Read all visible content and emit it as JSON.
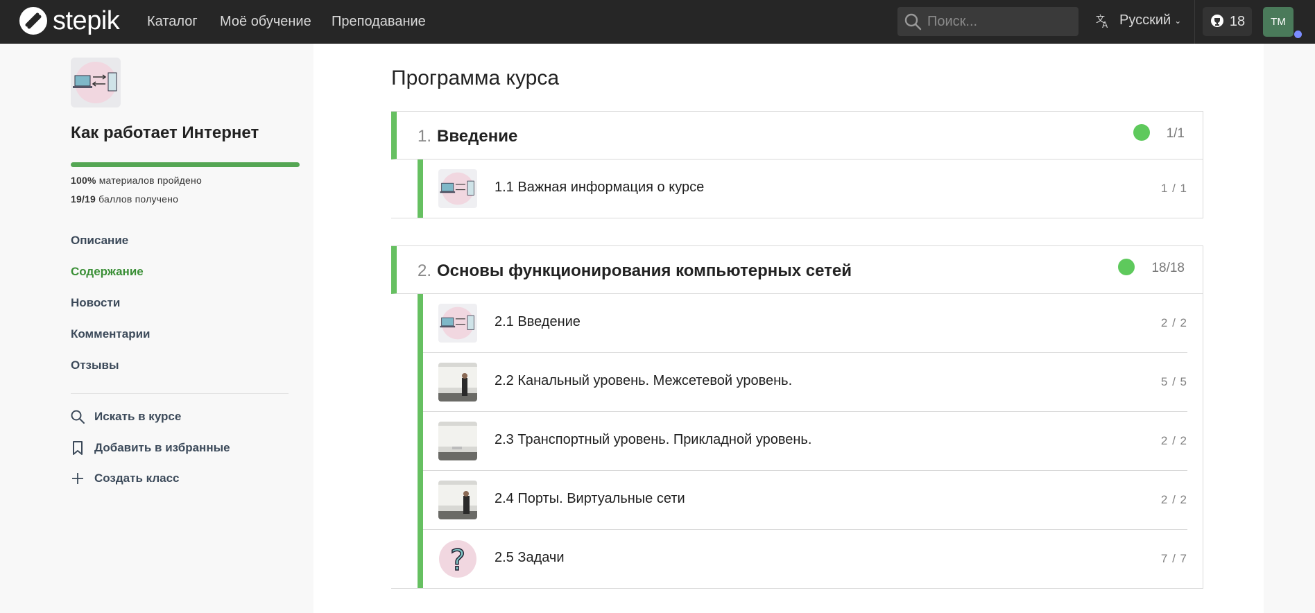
{
  "nav": {
    "logo_text": "stepik",
    "links": [
      "Каталог",
      "Моё обучение",
      "Преподавание"
    ],
    "search_placeholder": "Поиск...",
    "language": "Русский",
    "cups_count": "18",
    "avatar_initials": "TM"
  },
  "sidebar": {
    "course_title": "Как работает Интернет",
    "progress_percent": 100,
    "stat_materials_value": "100%",
    "stat_materials_label": "материалов пройдено",
    "stat_points_value": "19/19",
    "stat_points_label": "баллов получено",
    "menu": [
      "Описание",
      "Содержание",
      "Новости",
      "Комментарии",
      "Отзывы"
    ],
    "active_menu": "Содержание",
    "actions": [
      "Искать в курсе",
      "Добавить в избранные",
      "Создать класс"
    ]
  },
  "main": {
    "page_title": "Программа курса",
    "sections": [
      {
        "number": "1.",
        "title": "Введение",
        "score": "1/1",
        "lessons": [
          {
            "title": "1.1 Важная информация о курсе",
            "score": "1 / 1",
            "thumb": "network-icon"
          }
        ]
      },
      {
        "number": "2.",
        "title": "Основы функционирования компьютерных сетей",
        "score": "18/18",
        "lessons": [
          {
            "title": "2.1 Введение",
            "score": "2 / 2",
            "thumb": "network-icon"
          },
          {
            "title": "2.2 Канальный уровень. Межсетевой уровень.",
            "score": "5 / 5",
            "thumb": "lecture-photo"
          },
          {
            "title": "2.3 Транспортный уровень. Прикладной уровень.",
            "score": "2 / 2",
            "thumb": "lecture-photo"
          },
          {
            "title": "2.4 Порты. Виртуальные сети",
            "score": "2 / 2",
            "thumb": "lecture-photo"
          },
          {
            "title": "2.5 Задачи",
            "score": "7 / 7",
            "thumb": "question-icon"
          }
        ]
      }
    ]
  },
  "colors": {
    "navbar": "#262626",
    "accent_green": "#66c061",
    "active_link": "#3a8f36",
    "status_dot": "#5ec95c"
  }
}
